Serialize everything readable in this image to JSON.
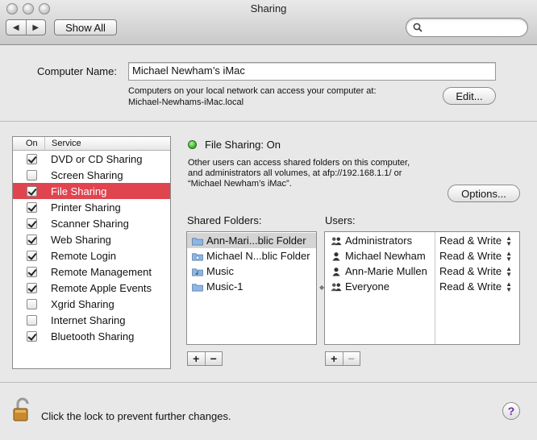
{
  "window": {
    "title": "Sharing",
    "back_glyph": "◀",
    "forward_glyph": "▶",
    "show_all_label": "Show All",
    "search_placeholder": ""
  },
  "computer_name": {
    "label": "Computer Name:",
    "value": "Michael Newham’s iMac",
    "info_line1": "Computers on your local network can access your computer at:",
    "info_line2": "Michael-Newhams-iMac.local",
    "edit_label": "Edit..."
  },
  "services": {
    "col_on": "On",
    "col_service": "Service",
    "items": [
      {
        "label": "DVD or CD Sharing",
        "on": true,
        "selected": false
      },
      {
        "label": "Screen Sharing",
        "on": false,
        "selected": false
      },
      {
        "label": "File Sharing",
        "on": true,
        "selected": true
      },
      {
        "label": "Printer Sharing",
        "on": true,
        "selected": false
      },
      {
        "label": "Scanner Sharing",
        "on": true,
        "selected": false
      },
      {
        "label": "Web Sharing",
        "on": true,
        "selected": false
      },
      {
        "label": "Remote Login",
        "on": true,
        "selected": false
      },
      {
        "label": "Remote Management",
        "on": true,
        "selected": false
      },
      {
        "label": "Remote Apple Events",
        "on": true,
        "selected": false
      },
      {
        "label": "Xgrid Sharing",
        "on": false,
        "selected": false
      },
      {
        "label": "Internet Sharing",
        "on": false,
        "selected": false
      },
      {
        "label": "Bluetooth Sharing",
        "on": true,
        "selected": false
      }
    ]
  },
  "status": {
    "title": "File Sharing: On",
    "led_color": "#3fb82c",
    "desc_line1": "Other users can access shared folders on this computer,",
    "desc_line2": "and administrators all volumes, at afp://192.168.1.1/ or",
    "desc_line3": "“Michael Newham’s iMac”.",
    "options_label": "Options..."
  },
  "shared_folders": {
    "label": "Shared Folders:",
    "items": [
      {
        "name": "Ann-Mari...blic Folder",
        "icon": "folder-icon",
        "selected": true
      },
      {
        "name": "Michael N...blic Folder",
        "icon": "public-folder-icon",
        "selected": false
      },
      {
        "name": "Music",
        "icon": "music-folder-icon",
        "selected": false
      },
      {
        "name": "Music-1",
        "icon": "folder-icon",
        "selected": false
      }
    ],
    "add_glyph": "+",
    "remove_glyph": "−"
  },
  "users": {
    "label": "Users:",
    "items": [
      {
        "name": "Administrators",
        "icon": "group-icon",
        "permission": "Read & Write"
      },
      {
        "name": "Michael Newham",
        "icon": "user-icon",
        "permission": "Read & Write"
      },
      {
        "name": "Ann-Marie Mullen",
        "icon": "user-icon",
        "permission": "Read & Write"
      },
      {
        "name": "Everyone",
        "icon": "group-icon",
        "permission": "Read & Write"
      }
    ],
    "add_glyph": "+",
    "remove_glyph": "−"
  },
  "footer": {
    "lock_text": "Click the lock to prevent further changes.",
    "help_glyph": "?"
  },
  "colors": {
    "selection_red": "#e0454f",
    "help_purple": "#6b2fa0"
  }
}
